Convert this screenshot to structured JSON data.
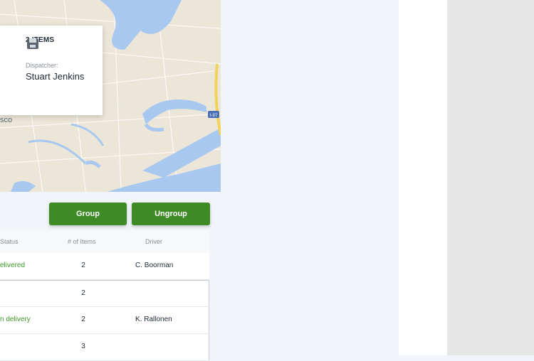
{
  "map_card": {
    "items_label": "2 ITEMS",
    "items_icon": "package-icon",
    "dispatcher_label": "Dispatcher:",
    "dispatcher_name": "Stuart Jenkins",
    "city_fragment": "sco"
  },
  "map": {
    "road_badge": "I-97"
  },
  "actions": {
    "group_label": "Group",
    "ungroup_label": "Ungroup"
  },
  "table": {
    "columns": {
      "status": "Status",
      "items": "# of Items",
      "driver": "Driver"
    },
    "rows": [
      {
        "status": "elivered",
        "items": "2",
        "driver": "C. Boorman"
      },
      {
        "status": "",
        "items": "2",
        "driver": ""
      },
      {
        "status": "n delivery",
        "items": "2",
        "driver": "K. Rallonen"
      },
      {
        "status": "",
        "items": "3",
        "driver": ""
      }
    ]
  },
  "colors": {
    "button_green": "#3e8b26",
    "status_green": "#3e9a2a",
    "water": "#a8c8f0",
    "land": "#ece6d8"
  }
}
